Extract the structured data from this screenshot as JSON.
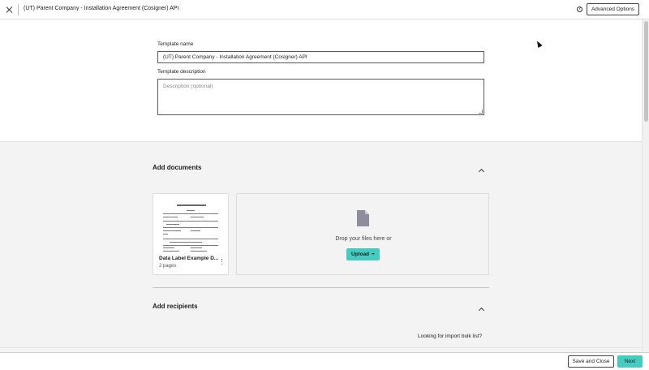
{
  "header": {
    "title": "(UT) Parent Company - Installation Agreement (Cosigner) API",
    "advanced_options_label": "Advanced Options",
    "help_glyph": "?"
  },
  "template_form": {
    "name_label": "Template name",
    "name_value": "(UT) Parent Company - Installation Agreement (Cosigner) API",
    "description_label": "Template description",
    "description_placeholder": "Description (optional)"
  },
  "documents_section": {
    "title": "Add documents",
    "document": {
      "name": "Data Label Example D...",
      "pages": "2 pages"
    },
    "drop_zone": {
      "text": "Drop your files here or",
      "upload_label": "Upload"
    }
  },
  "recipients_section": {
    "title": "Add recipients",
    "import_link": "Looking for import bulk list?"
  },
  "footer": {
    "save_close_label": "Save and Close",
    "next_label": "Next"
  },
  "colors": {
    "accent": "#45ccc0",
    "page_background": "#f4f3f4",
    "surface": "#ffffff"
  },
  "icons": [
    "close-icon",
    "help-icon",
    "chevron-up-icon",
    "file-icon",
    "caret-down-icon",
    "kebab-menu-icon",
    "cursor-icon"
  ]
}
